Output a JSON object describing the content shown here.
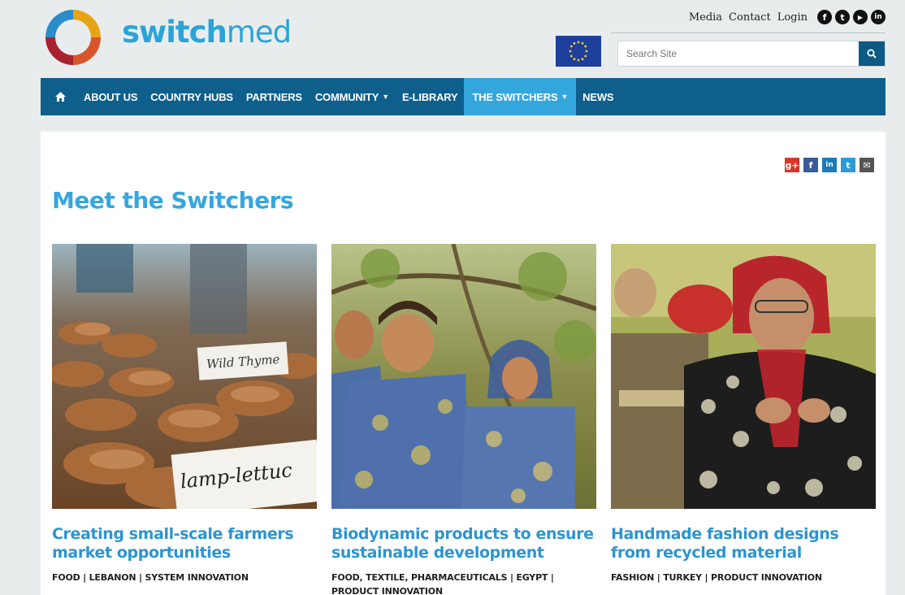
{
  "brand": {
    "name_part1": "sw",
    "name_part2": "i",
    "name_part3": "tch",
    "name_part4": "med"
  },
  "top_links": {
    "media": "Media",
    "contact": "Contact",
    "login": "Login"
  },
  "social": {
    "facebook": "f",
    "twitter": "t",
    "youtube": "▶",
    "linkedin": "in"
  },
  "search": {
    "placeholder": "Search Site",
    "icon": "search-icon"
  },
  "nav": {
    "home_icon": "home-icon",
    "items": [
      {
        "label": "ABOUT US"
      },
      {
        "label": "COUNTRY HUBS"
      },
      {
        "label": "PARTNERS"
      },
      {
        "label": "COMMUNITY"
      },
      {
        "label": "E-LIBRARY"
      },
      {
        "label": "THE SWITCHERS"
      },
      {
        "label": "NEWS"
      }
    ]
  },
  "share": {
    "gplus": "g+",
    "facebook": "f",
    "linkedin": "in",
    "twitter": "t",
    "email": "✉"
  },
  "page": {
    "title": "Meet the Switchers"
  },
  "cards": [
    {
      "title": "Creating small-scale farmers market opportunities",
      "tags": "FOOD | LEBANON | SYSTEM INNOVATION",
      "sign1": "Wild Thyme",
      "sign2": "lamp-lettuc"
    },
    {
      "title": "Biodynamic products to ensure sustainable development",
      "tags": "FOOD, TEXTILE, PHARMACEUTICALS | EGYPT | PRODUCT INNOVATION"
    },
    {
      "title": "Handmade fashion designs from recycled material",
      "tags": "FASHION | TURKEY | PRODUCT INNOVATION"
    }
  ],
  "colors": {
    "nav_bg": "#0e5f8c",
    "nav_active": "#34a6de",
    "accent": "#36a6de"
  }
}
